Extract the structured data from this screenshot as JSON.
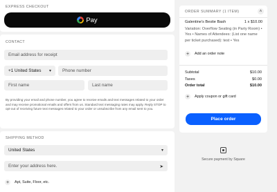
{
  "express": {
    "label": "Express Checkout",
    "gpay_label": "Pay"
  },
  "contact": {
    "label": "Contact",
    "email_placeholder": "Email address for receipt",
    "country_code": "+1 United States",
    "phone_placeholder": "Phone number",
    "first_name_placeholder": "First name",
    "last_name_placeholder": "Last name",
    "disclaimer": "By providing your email and phone number, you agree to receive emails and text messages related to your order and may receive promotional emails and offers from us. Standard text messaging rates may apply. Reply STOP to opt-out of receiving future text messages related to your order or unsubscribe from any email sent to you."
  },
  "shipping": {
    "label": "Shipping Method",
    "country": "United States",
    "address_placeholder": "Enter your address here.",
    "apt_label": "Apt, Suite, Floor, etc."
  },
  "summary": {
    "label": "Order Summary (1 Item)",
    "item_name": "Galentine's Bestie Bash",
    "item_qty_price": "1 x $10.00",
    "item_detail": "Variation: Overflow Seating (in Party Room) • Yes • Names of Attendees: (List one name per ticket purchased): test • Yes",
    "add_note": "Add an order note",
    "subtotal_label": "Subtotal",
    "subtotal_value": "$10.00",
    "taxes_label": "Taxes",
    "taxes_value": "$0.00",
    "total_label": "Order total",
    "total_value": "$10.00",
    "coupon_label": "Apply coupon or gift card",
    "place_order": "Place order"
  },
  "footer": {
    "secure_text": "Secure payment by Square"
  },
  "colors": {
    "accent": "#0a60ff",
    "gpay_bg": "#0a0a0a",
    "page_bg": "#f2f2f2"
  },
  "icons": [
    "google-logo-icon",
    "chevron-down-icon",
    "location-arrow-icon",
    "plus-icon",
    "chevron-up-icon",
    "square-logo-icon"
  ]
}
